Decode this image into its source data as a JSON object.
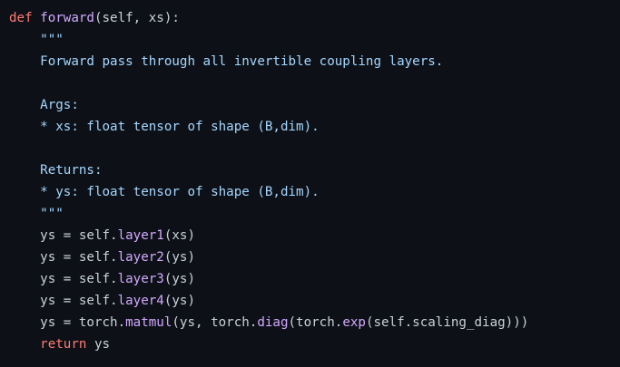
{
  "code": {
    "lines": [
      [
        {
          "text": "def",
          "type": "kw"
        },
        {
          "text": " ",
          "type": "plain"
        },
        {
          "text": "forward",
          "type": "fn"
        },
        {
          "text": "(self, xs):",
          "type": "plain"
        }
      ],
      [
        {
          "text": "    \"\"\"",
          "type": "doc"
        }
      ],
      [
        {
          "text": "    Forward pass through all invertible coupling layers.",
          "type": "doc"
        }
      ],
      [
        {
          "text": "",
          "type": "plain"
        }
      ],
      [
        {
          "text": "    Args:",
          "type": "doc"
        }
      ],
      [
        {
          "text": "    * xs: float tensor of shape (B,dim).",
          "type": "doc"
        }
      ],
      [
        {
          "text": "",
          "type": "plain"
        }
      ],
      [
        {
          "text": "    Returns:",
          "type": "doc"
        }
      ],
      [
        {
          "text": "    * ys: float tensor of shape (B,dim).",
          "type": "doc"
        }
      ],
      [
        {
          "text": "    \"\"\"",
          "type": "doc"
        }
      ],
      [
        {
          "text": "    ys = self.",
          "type": "plain"
        },
        {
          "text": "layer1",
          "type": "fn"
        },
        {
          "text": "(xs)",
          "type": "plain"
        }
      ],
      [
        {
          "text": "    ys = self.",
          "type": "plain"
        },
        {
          "text": "layer2",
          "type": "fn"
        },
        {
          "text": "(ys)",
          "type": "plain"
        }
      ],
      [
        {
          "text": "    ys = self.",
          "type": "plain"
        },
        {
          "text": "layer3",
          "type": "fn"
        },
        {
          "text": "(ys)",
          "type": "plain"
        }
      ],
      [
        {
          "text": "    ys = self.",
          "type": "plain"
        },
        {
          "text": "layer4",
          "type": "fn"
        },
        {
          "text": "(ys)",
          "type": "plain"
        }
      ],
      [
        {
          "text": "    ys = torch.",
          "type": "plain"
        },
        {
          "text": "matmul",
          "type": "fn"
        },
        {
          "text": "(ys, torch.",
          "type": "plain"
        },
        {
          "text": "diag",
          "type": "fn"
        },
        {
          "text": "(torch.",
          "type": "plain"
        },
        {
          "text": "exp",
          "type": "fn"
        },
        {
          "text": "(self.scaling_diag)))",
          "type": "plain"
        }
      ],
      [
        {
          "text": "    ",
          "type": "plain"
        },
        {
          "text": "return",
          "type": "kw"
        },
        {
          "text": " ys",
          "type": "plain"
        }
      ]
    ]
  },
  "colors": {
    "background": "#0d1117",
    "keyword": "#ff7b72",
    "function": "#d2a8ff",
    "docstring": "#a5d6ff",
    "text": "#c9d1d9"
  }
}
